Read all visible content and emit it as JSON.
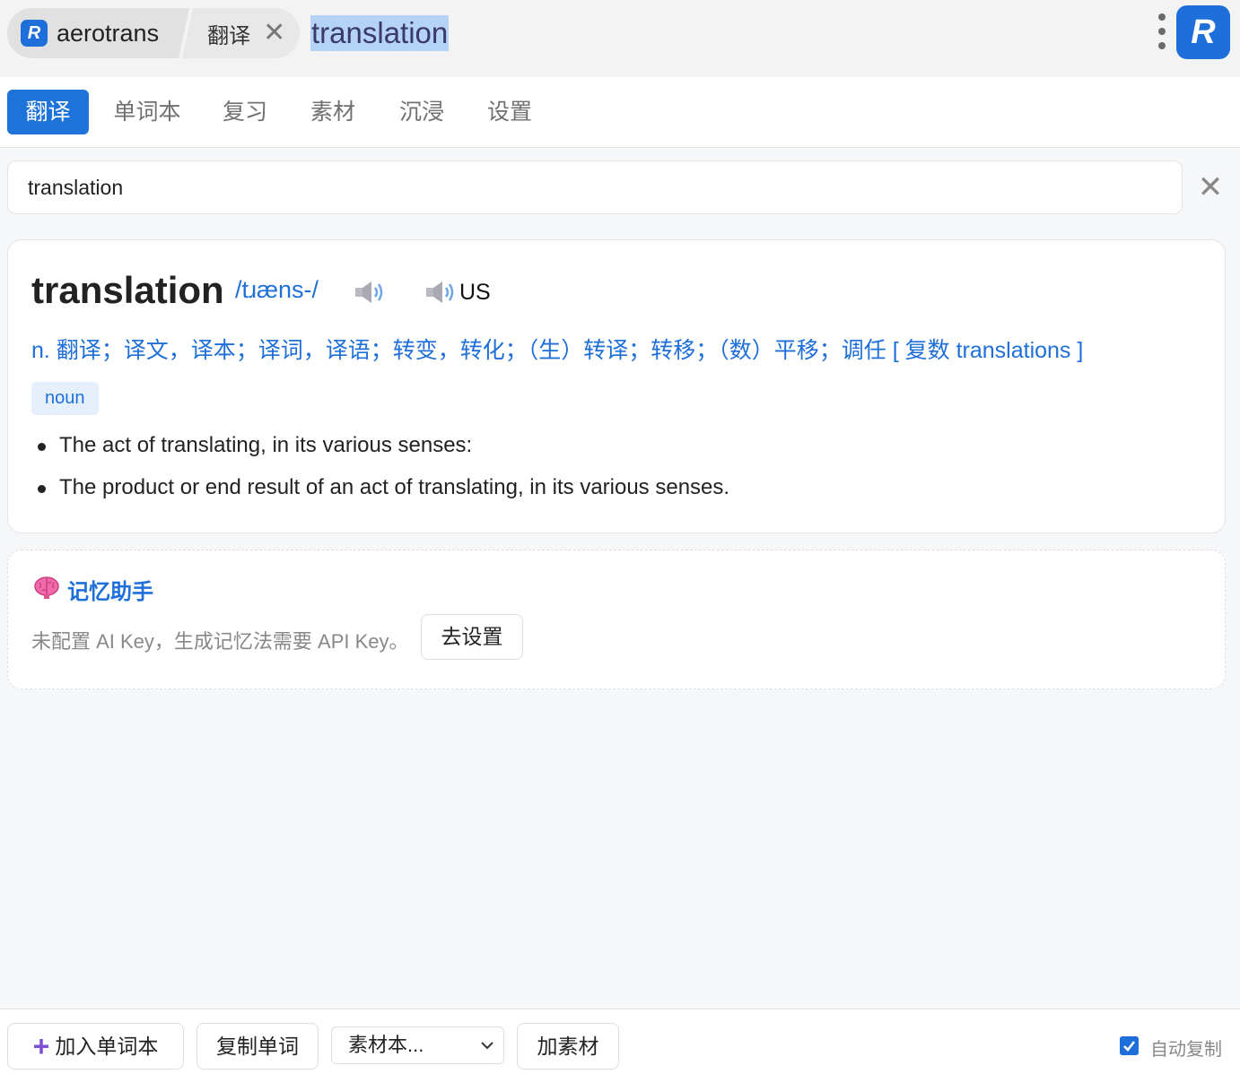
{
  "topbar": {
    "app_icon_letter": "R",
    "app_name": "aerotrans",
    "tab_label": "翻译",
    "tab_close_glyph": "✕",
    "query": "translation",
    "more_icon": "more-vertical-icon",
    "logo_letter": "R"
  },
  "nav": {
    "tabs": [
      {
        "label": "翻译",
        "active": true
      },
      {
        "label": "单词本",
        "active": false
      },
      {
        "label": "复习",
        "active": false
      },
      {
        "label": "素材",
        "active": false
      },
      {
        "label": "沉浸",
        "active": false
      },
      {
        "label": "设置",
        "active": false
      }
    ]
  },
  "search": {
    "value": "translation",
    "clear_glyph": "✕"
  },
  "entry": {
    "word": "translation",
    "phonetic": "/tɹæns-/",
    "us_label": "US",
    "definition": "n. 翻译；译文，译本；译词，译语；转变，转化；（生）转译；转移；（数）平移；调任 [ 复数 translations ]",
    "pos": "noun",
    "senses": [
      "The act of translating, in its various senses:",
      "The product or end result of an act of translating, in its various senses."
    ]
  },
  "memory": {
    "icon": "brain-icon",
    "title": "记忆助手",
    "message": "未配置 AI Key，生成记忆法需要 API Key。",
    "setup_button": "去设置"
  },
  "bottombar": {
    "add_button": "加入单词本",
    "copy_button": "复制单词",
    "material_select": "素材本...",
    "add_material_button": "加素材",
    "auto_copy_label": "自动复制",
    "auto_copy_checked": true
  },
  "colors": {
    "accent": "#1e6fd9",
    "selection": "#b5d2f7",
    "badge_bg": "#e6f0fc"
  }
}
